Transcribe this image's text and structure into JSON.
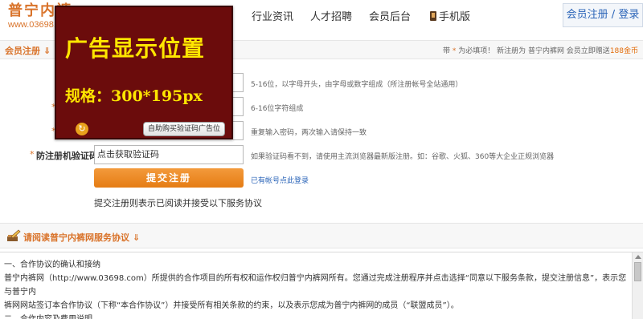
{
  "header": {
    "logo_text": "普宁内裤",
    "logo_url": "www.03698.com",
    "nav": [
      "行业资讯",
      "人才招聘",
      "会员后台",
      "手机版"
    ],
    "register_label": "会员注册",
    "separator": "/",
    "login_label": "登录"
  },
  "section": {
    "title": "会员注册 ⇓",
    "note_prefix": "带",
    "note_star": "*",
    "note_middle": "为必填项！ 新注册为 普宁内裤网 会员立即赠送",
    "note_gold": "188金币"
  },
  "form": {
    "hints": [
      "5-16位，以字母开头，由字母或数字组成（所注册帐号全站通用）",
      "6-16位字符组成",
      "重复输入密码，两次输入请保持一致",
      "如果验证码看不到，请使用主流浏览器最新版注册。如：谷歌、火狐、360等大企业正规浏览器"
    ],
    "captcha_label": "防注册机验证码",
    "captcha_value": "点击获取验证码",
    "submit_label": "提交注册",
    "has_account_link": "已有帐号点此登录",
    "agree_text": "提交注册则表示已阅读并接受以下服务协议",
    "required_mark": "*"
  },
  "ad": {
    "line1": "广告显示位置",
    "line2": "规格：300*195px",
    "buy_button": "自助购买验证码广告位",
    "refresh_glyph": "↻"
  },
  "agreement": {
    "title": "请阅读普宁内裤网服务协议 ⇓",
    "lines": [
      "一、合作协议的确认和接纳",
      "普宁内裤网（http://www.03698.com）所提供的合作项目的所有权和运作权归普宁内裤网所有。您通过完成注册程序并点击选择“同意以下服务条款，提交注册信息”，表示您与普宁内",
      "裤网网站签订本合作协议（下称“本合作协议”）并接受所有相关条款的约束，以及表示您成为普宁内裤网的成员（“联盟成员”）。",
      "二、合作内容及费用说明"
    ]
  },
  "colors": {
    "accent": "#d9732a",
    "link": "#2a64b8",
    "ad_bg": "#6b0c0c",
    "ad_text": "#ffe600",
    "button": "#e57c14"
  }
}
